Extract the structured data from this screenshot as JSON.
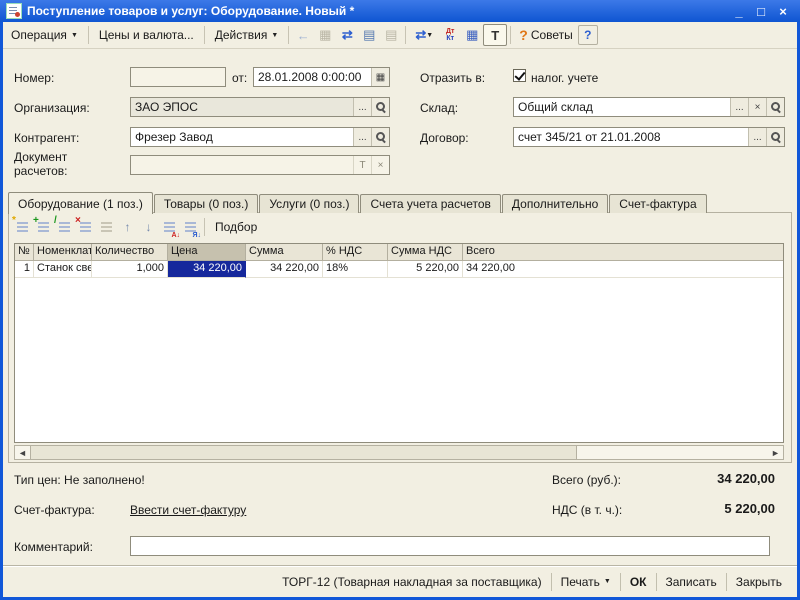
{
  "window": {
    "title": "Поступление товаров и услуг: Оборудование. Новый *",
    "minimize": "_",
    "maximize": "□",
    "close": "×"
  },
  "toolbar": {
    "operation": {
      "label": "Операция",
      "caret": "▼"
    },
    "prices_currency": {
      "label": "Цены и валюта..."
    },
    "actions": {
      "label": "Действия",
      "caret": "▼"
    },
    "icons": [
      {
        "name": "back-icon",
        "glyph": "←",
        "style": "color:#9fb2d2"
      },
      {
        "name": "reread-icon",
        "glyph": "▦",
        "style": "color:#b9b5a5"
      },
      {
        "name": "refresh-icon",
        "glyph": "⇄",
        "style": "color:#2d5fd0;font-weight:bold"
      },
      {
        "name": "post-document-icon",
        "glyph": "▤",
        "style": "color:#5578b0"
      },
      {
        "name": "cancel-posting-icon",
        "glyph": "▤",
        "style": "color:#b9b5a5"
      },
      {
        "name": "goto-icon",
        "glyph": "⇄",
        "style": "color:#2d5fd0;font-weight:bold"
      },
      {
        "name": "report-icon",
        "glyph": "▦",
        "style": "color:#3a5fc0"
      },
      {
        "name": "text-toggle-icon",
        "glyph": "T",
        "style": "color:#333333;font-weight:bold"
      },
      {
        "name": "tips-icon",
        "glyph": "?",
        "style": "color:#e07818;font-weight:bold;font-size:14px"
      },
      {
        "name": "help-icon",
        "glyph": "?",
        "style": "color:#2d5fd0;font-weight:bold"
      }
    ],
    "goto_caret": "▼",
    "dtkt": {
      "top": "Дт",
      "bottom": "Кт"
    },
    "tips_label": "Советы"
  },
  "form": {
    "number_label": "Номер:",
    "number_value": "",
    "date_label": "от:",
    "date_value": "28.01.2008 0:00:00",
    "calendar_glyph": "▦",
    "organization_label": "Организация:",
    "organization_value": "ЗАО ЭПОС",
    "counterparty_label": "Контрагент:",
    "counterparty_value": "Фрезер Завод",
    "settlement_label_1": "Документ",
    "settlement_label_2": "расчетов:",
    "settlement_value": "",
    "settlement_type_button": "Т",
    "settlement_clear_button": "×",
    "reflect_label": "Отразить в:",
    "reflect_checkbox_label": "налог. учете",
    "warehouse_label": "Склад:",
    "warehouse_value": "Общий склад",
    "contract_label": "Договор:",
    "contract_value": "счет 345/21 от 21.01.2008",
    "ellipsis_button": "...",
    "clear_button": "×"
  },
  "tabs": [
    {
      "label": "Оборудование (1 поз.)",
      "active": true
    },
    {
      "label": "Товары (0 поз.)",
      "active": false
    },
    {
      "label": "Услуги (0 поз.)",
      "active": false
    },
    {
      "label": "Счета учета расчетов",
      "active": false
    },
    {
      "label": "Дополнительно",
      "active": false
    },
    {
      "label": "Счет-фактура",
      "active": false
    }
  ],
  "equipment_toolbar": {
    "icons": [
      {
        "name": "add-row-icon",
        "badge": "*",
        "badge_style": "color:#e0a800"
      },
      {
        "name": "add-copy-icon",
        "badge": "+",
        "badge_style": "color:#18961a"
      },
      {
        "name": "edit-row-icon",
        "badge": "/",
        "badge_style": "color:#18961a"
      },
      {
        "name": "delete-row-icon",
        "badge": "×",
        "badge_style": "color:#cc2020"
      },
      {
        "name": "end-edit-icon",
        "badge": "",
        "badge_style": "color:#a8a494"
      },
      {
        "name": "move-up-icon",
        "glyph": "↑"
      },
      {
        "name": "move-down-icon",
        "glyph": "↓"
      },
      {
        "name": "sort-asc-icon",
        "badge": "А↓",
        "badge_style": "color:#cc2020"
      },
      {
        "name": "sort-desc-icon",
        "badge": "Я↓",
        "badge_style": "color:#2d5fd0"
      }
    ],
    "pick_button": "Подбор"
  },
  "table": {
    "columns": [
      "№",
      "Номенклат...",
      "Количество",
      "Цена",
      "Сумма",
      "% НДС",
      "Сумма НДС",
      "Всего"
    ],
    "rows": [
      [
        "1",
        "Станок све...",
        "1,000",
        "34 220,00",
        "34 220,00",
        "18%",
        "5 220,00",
        "34 220,00"
      ]
    ]
  },
  "scrollbar": {
    "left": "◄",
    "right": "►"
  },
  "footer": {
    "price_type": "Тип цен: Не заполнено!",
    "invoice_label": "Счет-фактура:",
    "invoice_link": "Ввести счет-фактуру",
    "total_label": "Всего (руб.):",
    "total_value": "34 220,00",
    "vat_label": "НДС (в т. ч.):",
    "vat_value": "5 220,00",
    "comment_label": "Комментарий:",
    "comment_value": ""
  },
  "bottom_bar": {
    "torg12": "ТОРГ-12 (Товарная накладная за поставщика)",
    "print": "Печать",
    "print_caret": "▼",
    "ok": "ОК",
    "save": "Записать",
    "close": "Закрыть"
  }
}
